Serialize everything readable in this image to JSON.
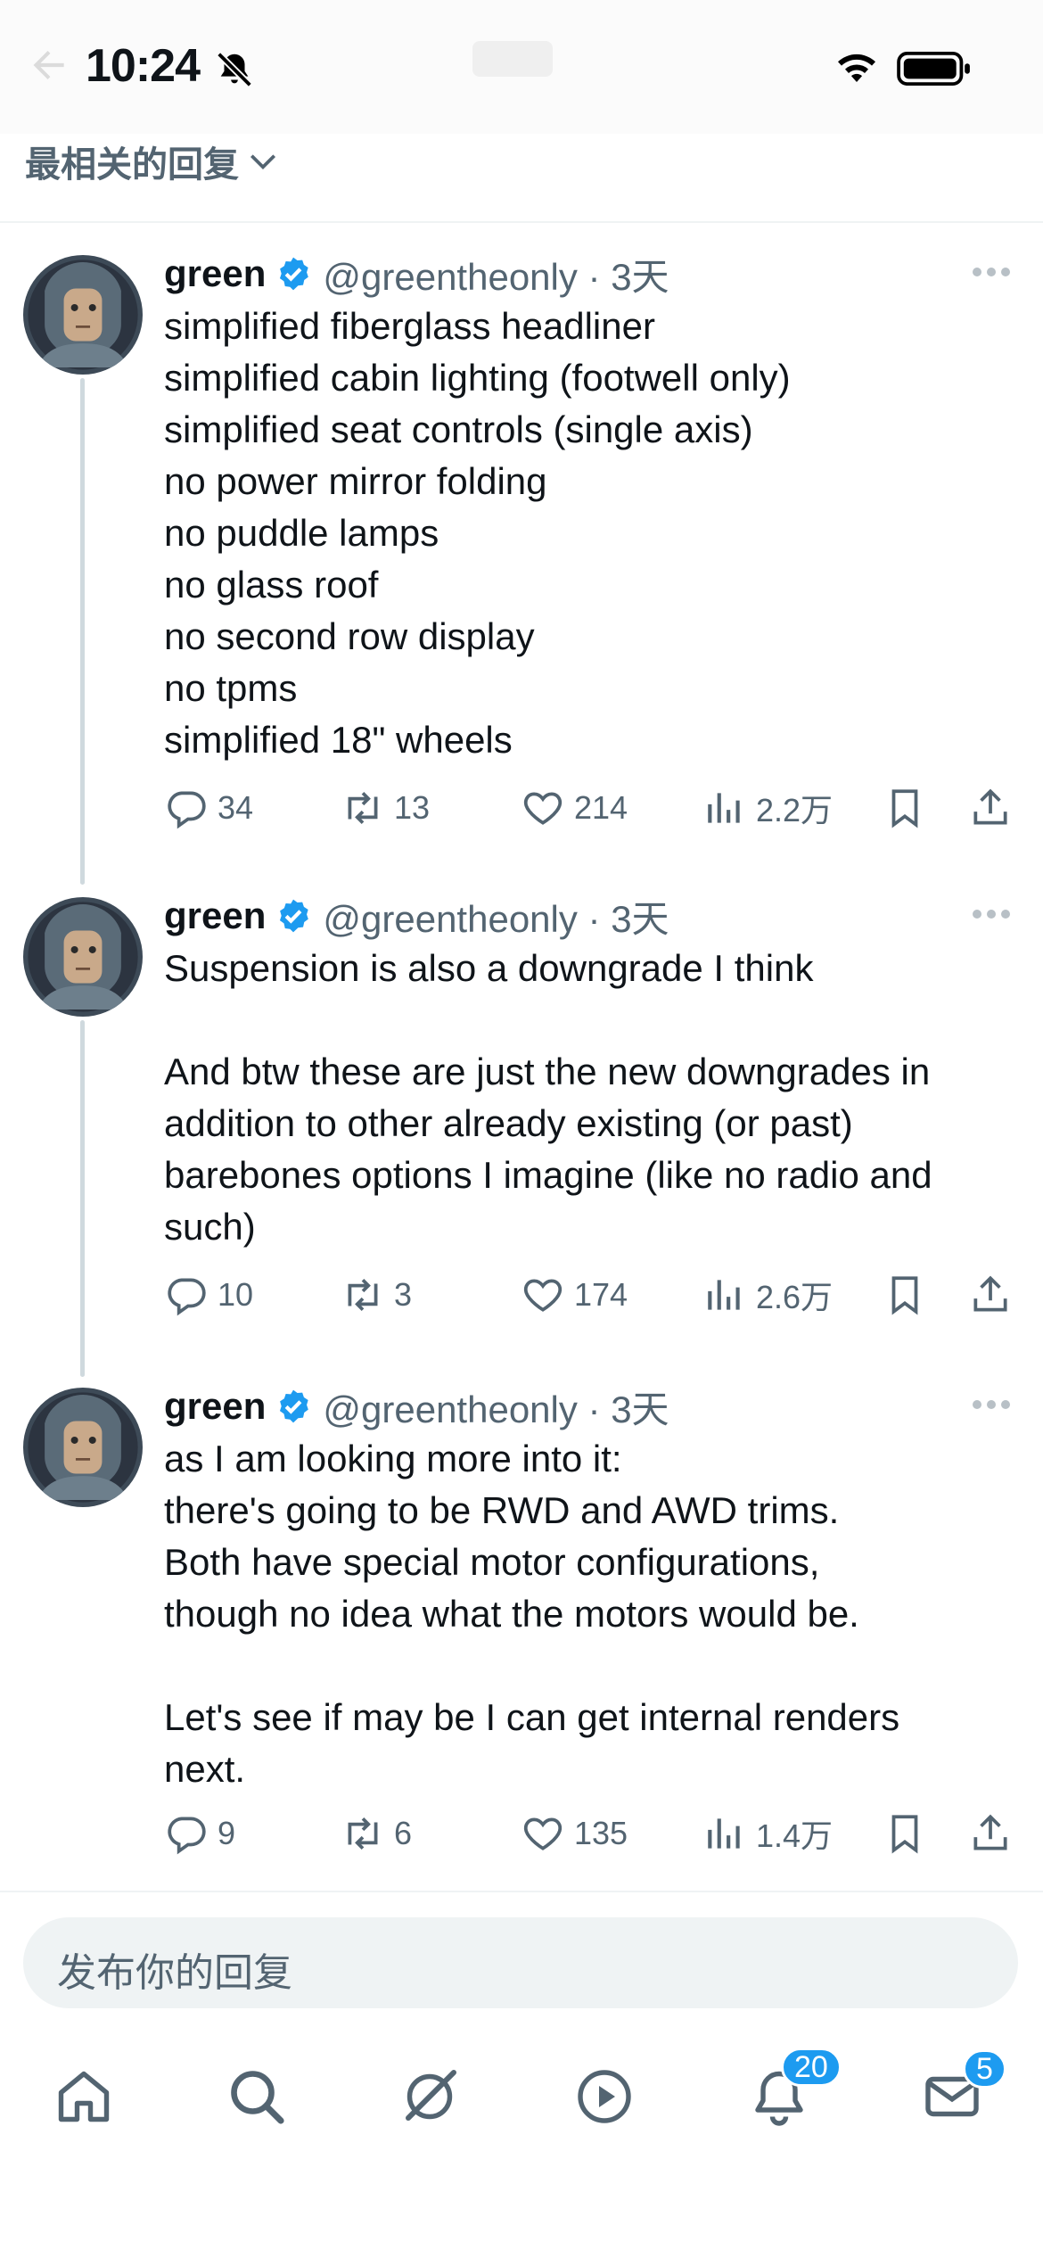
{
  "status_bar": {
    "time": "10:24"
  },
  "header": {
    "sort_label": "最相关的回复"
  },
  "tweets": [
    {
      "name": "green",
      "handle": "@greentheonly · 3天",
      "lines": [
        "simplified fiberglass headliner",
        "simplified cabin lighting (footwell only)",
        "simplified seat controls (single axis)",
        "no power mirror folding",
        "no puddle lamps",
        "no glass roof",
        "no second row display",
        "no tpms",
        "simplified 18\" wheels"
      ],
      "replies": "34",
      "reposts": "13",
      "likes": "214",
      "views": "2.2万"
    },
    {
      "name": "green",
      "handle": "@greentheonly · 3天",
      "lines": [
        "Suspension is also a downgrade I think",
        "",
        "And btw these are just the new downgrades in",
        "addition to other already existing (or past)",
        "barebones options I imagine (like no radio and",
        "such)"
      ],
      "replies": "10",
      "reposts": "3",
      "likes": "174",
      "views": "2.6万"
    },
    {
      "name": "green",
      "handle": "@greentheonly · 3天",
      "lines": [
        "as I am looking more into it:",
        "there's going to be RWD and AWD trims.",
        "Both have special motor configurations,",
        "though no idea what the motors would be.",
        "",
        "Let's see if may be I can get internal renders",
        "next."
      ],
      "replies": "9",
      "reposts": "6",
      "likes": "135",
      "views": "1.4万"
    }
  ],
  "reply_box": {
    "placeholder": "发布你的回复"
  },
  "tab_bar": {
    "notifications_badge": "20",
    "messages_badge": "5"
  },
  "colors": {
    "accent": "#1d9bf0",
    "text_primary": "#0f1419",
    "text_secondary": "#536471",
    "thread_line": "#cfd9de"
  }
}
